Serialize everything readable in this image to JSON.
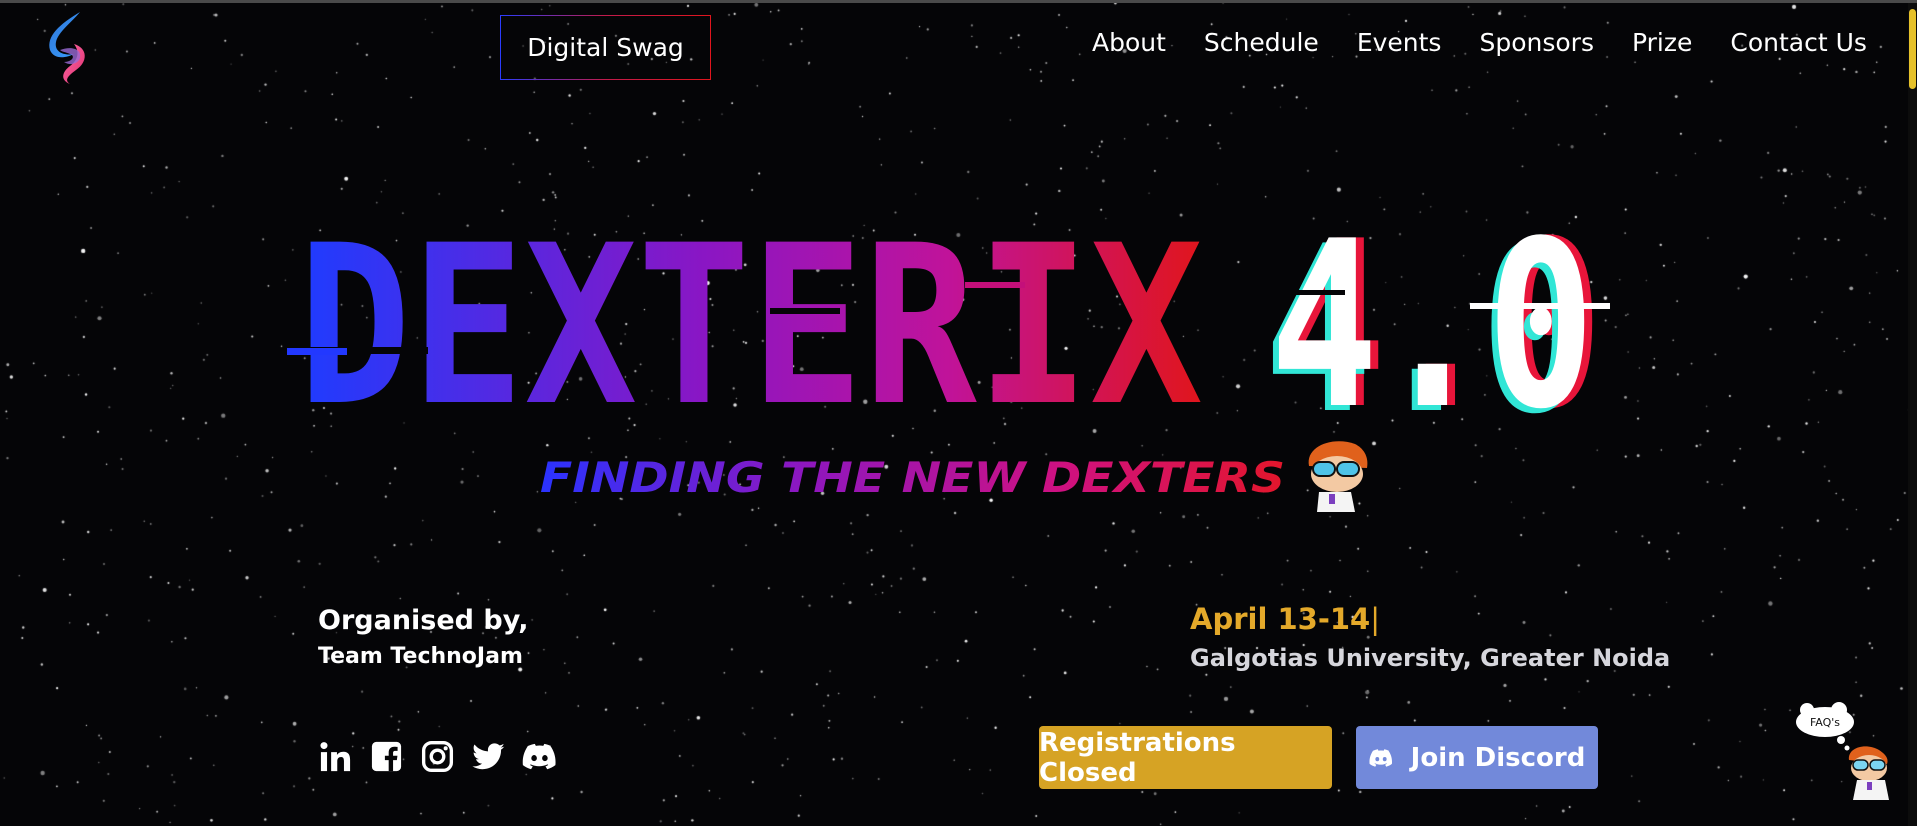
{
  "nav": {
    "swag_label": "Digital Swag",
    "items": [
      {
        "label": "About"
      },
      {
        "label": "Schedule"
      },
      {
        "label": "Events"
      },
      {
        "label": "Sponsors"
      },
      {
        "label": "Prize"
      },
      {
        "label": "Contact Us"
      }
    ]
  },
  "hero": {
    "title_main": "DEXTERIX",
    "title_version": "4.0",
    "tagline": "FINDING THE NEW DEXTERS"
  },
  "organiser": {
    "label": "Organised by,",
    "name": "Team TechnoJam"
  },
  "event": {
    "date": "April 13-14",
    "caret": "|",
    "venue": "Galgotias University, Greater Noida"
  },
  "socials": [
    {
      "icon": "linkedin-icon"
    },
    {
      "icon": "facebook-icon"
    },
    {
      "icon": "instagram-icon"
    },
    {
      "icon": "twitter-icon"
    },
    {
      "icon": "discord-icon"
    }
  ],
  "buttons": {
    "registration": "Registrations Closed",
    "discord": "Join Discord"
  },
  "faq": {
    "label": "FAQ's"
  },
  "colors": {
    "background": "#050507",
    "accent_gold": "#d6a324",
    "discord": "#7289da",
    "gradient_start": "#1e3cff",
    "gradient_mid": "#b30fa8",
    "gradient_end": "#e0151d"
  }
}
